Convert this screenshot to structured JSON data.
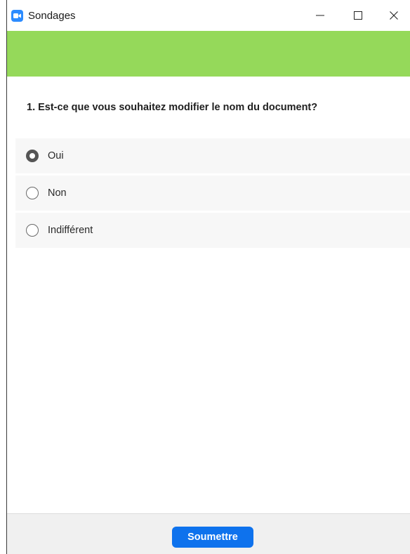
{
  "window": {
    "title": "Sondages",
    "app_icon": "zoom-camera-icon",
    "controls": [
      "minimize-icon",
      "maximize-icon",
      "close-icon"
    ]
  },
  "colors": {
    "banner": "#95d95a",
    "accent": "#0e72ed",
    "app_icon": "#2d8cff"
  },
  "poll": {
    "question": "1. Est-ce que vous souhaitez modifier le nom du document?",
    "options": [
      {
        "label": "Oui",
        "selected": true
      },
      {
        "label": "Non",
        "selected": false
      },
      {
        "label": "Indifférent",
        "selected": false
      }
    ]
  },
  "footer": {
    "submit_label": "Soumettre"
  }
}
